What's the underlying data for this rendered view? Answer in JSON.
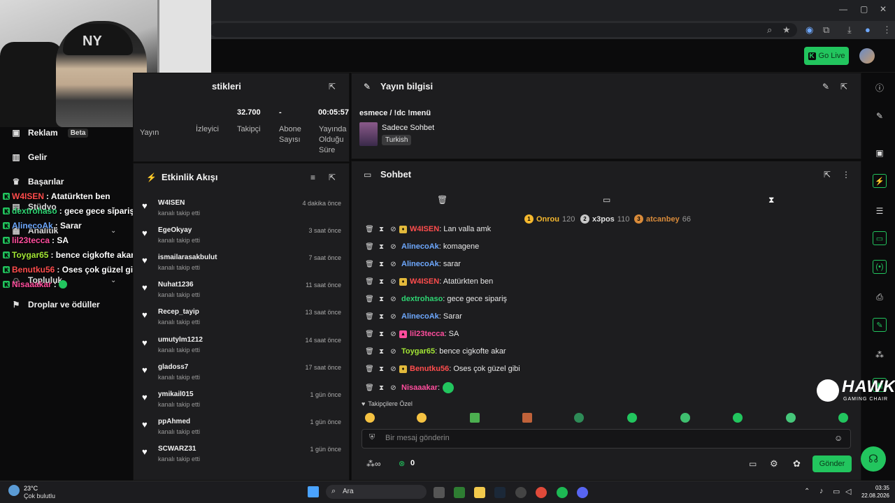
{
  "sidebar": {
    "items": [
      {
        "icon": "ad-icon",
        "label": "Reklam",
        "badge": "Beta"
      },
      {
        "icon": "income-icon",
        "label": "Gelir"
      },
      {
        "icon": "trophy-icon",
        "label": "Başarılar"
      },
      {
        "icon": "studio-icon",
        "label": "Stüdyo"
      },
      {
        "icon": "analytics-icon",
        "label": "Analitik"
      },
      {
        "icon": "community-icon",
        "label": "Topluluk"
      },
      {
        "icon": "gift-icon",
        "label": "Droplar ve ödüller"
      }
    ]
  },
  "overlay_chat": [
    {
      "user": "W4ISEN",
      "text": ": Atatürkten ben",
      "color": "#ff4d4d"
    },
    {
      "user": "dextrohaso",
      "text": ": gece gece sipariş",
      "color": "#2ed573"
    },
    {
      "user": "AlinecoAk",
      "text": ": Sarar",
      "color": "#6ea8fe"
    },
    {
      "user": "lil23tecca",
      "text": ": SA",
      "color": "#ff4d9d"
    },
    {
      "user": "Toygar65",
      "text": ": bence cigkofte akar",
      "color": "#a3e635"
    },
    {
      "user": "Benutku56",
      "text": ": Oses çok güzel gibi",
      "color": "#ff4d4d"
    },
    {
      "user": "Nisaaakar",
      "text": ":",
      "color": "#ff4d9d"
    }
  ],
  "header": {
    "go_live": "Go Live"
  },
  "stats": {
    "title": "stikleri",
    "columns": [
      {
        "label": "Yayın",
        "value": ""
      },
      {
        "label": "İzleyici",
        "value": ""
      },
      {
        "label": "Takipçi",
        "value": "32.700"
      },
      {
        "label": "Abone Sayısı",
        "value": "-"
      },
      {
        "label": "Yayında Olduğu Süre",
        "value": "00:05:57"
      }
    ]
  },
  "stream_info": {
    "title": "Yayın bilgisi",
    "stream_title": "esmece / !dc !menü",
    "category": "Sadece Sohbet",
    "language": "Turkish"
  },
  "activity": {
    "title": "Etkinlik Akışı",
    "items": [
      {
        "name": "W4ISEN",
        "sub": "kanalı takip etti",
        "time": "4 dakika önce"
      },
      {
        "name": "EgeOkyay",
        "sub": "kanalı takip etti",
        "time": "3 saat önce"
      },
      {
        "name": "ismailarasakbulut",
        "sub": "kanalı takip etti",
        "time": "7 saat önce"
      },
      {
        "name": "Nuhat1236",
        "sub": "kanalı takip etti",
        "time": "11 saat önce"
      },
      {
        "name": "Recep_tayip",
        "sub": "kanalı takip etti",
        "time": "13 saat önce"
      },
      {
        "name": "umutylm1212",
        "sub": "kanalı takip etti",
        "time": "14 saat önce"
      },
      {
        "name": "gladoss7",
        "sub": "kanalı takip etti",
        "time": "17 saat önce"
      },
      {
        "name": "ymikail015",
        "sub": "kanalı takip etti",
        "time": "1 gün önce"
      },
      {
        "name": "ppAhmed",
        "sub": "kanalı takip etti",
        "time": "1 gün önce"
      },
      {
        "name": "SCWARZ31",
        "sub": "kanalı takip etti",
        "time": "1 gün önce"
      }
    ]
  },
  "chat": {
    "title": "Sohbet",
    "leaderboard": [
      {
        "rank": "1",
        "name": "Onrou",
        "score": "120",
        "color": "#f5b82e"
      },
      {
        "rank": "2",
        "name": "x3pos",
        "score": "110",
        "color": "#c8c8c8"
      },
      {
        "rank": "3",
        "name": "atcanbey",
        "score": "66",
        "color": "#d98b3a"
      }
    ],
    "messages": [
      {
        "user": "W4ISEN",
        "text": ": Lan valla amk",
        "color": "#ff4d4d",
        "badge": true
      },
      {
        "user": "AlinecoAk",
        "text": ": komagene",
        "color": "#6ea8fe",
        "badge": false
      },
      {
        "user": "AlinecoAk",
        "text": ": sarar",
        "color": "#6ea8fe",
        "badge": false
      },
      {
        "user": "W4ISEN",
        "text": ": Atatürkten ben",
        "color": "#ff4d4d",
        "badge": true
      },
      {
        "user": "dextrohaso",
        "text": ": gece gece sipariş",
        "color": "#2ed573",
        "badge": false
      },
      {
        "user": "AlinecoAk",
        "text": ": Sarar",
        "color": "#6ea8fe",
        "badge": false
      },
      {
        "user": "lil23tecca",
        "text": ": SA",
        "color": "#ff4d9d",
        "badge": true
      },
      {
        "user": "Toygar65",
        "text": ": bence cigkofte akar",
        "color": "#a3e635",
        "badge": false
      },
      {
        "user": "Benutku56",
        "text": ": Oses çok güzel gibi",
        "color": "#ff4d4d",
        "badge": true
      },
      {
        "user": "Nisaaakar",
        "text": ":",
        "color": "#ff4d9d",
        "badge": false
      }
    ],
    "emote_section": "Takipçilere Özel",
    "input_placeholder": "Bir mesaj gönderin",
    "points": "0",
    "send_label": "Gönder"
  },
  "taskbar": {
    "weather_temp": "23°C",
    "weather_desc": "Çok bulutlu",
    "search": "Ara",
    "time": "03:35",
    "date": "22.08.2026"
  },
  "brand": {
    "logo": "HAWK",
    "sub": "GAMING CHAIR"
  }
}
